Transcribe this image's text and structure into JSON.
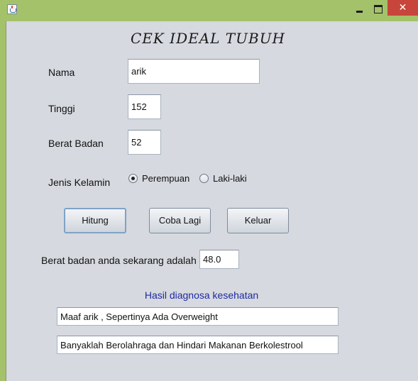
{
  "window": {
    "icon": "java-cup-icon",
    "controls": {
      "minimize": "minimize-icon",
      "maximize": "maximize-icon",
      "close": "close-icon"
    }
  },
  "form": {
    "title": "CEK IDEAL TUBUH",
    "nama_label": "Nama",
    "nama_value": "arik",
    "tinggi_label": "Tinggi",
    "tinggi_value": "152",
    "berat_label": "Berat Badan",
    "berat_value": "52",
    "gender_label": "Jenis Kelamin",
    "gender_options": [
      "Perempuan",
      "Laki-laki"
    ],
    "gender_selected": "Perempuan"
  },
  "buttons": {
    "hitung": "Hitung",
    "coba_lagi": "Coba Lagi",
    "keluar": "Keluar"
  },
  "result": {
    "label": "Berat badan anda sekarang adalah",
    "value": "48.0"
  },
  "diagnosis": {
    "heading": "Hasil diagnosa kesehatan",
    "line1": "Maaf arik , Sepertinya Ada Overweight",
    "line2": "Banyaklah Berolahraga dan Hindari Makanan Berkolestrool"
  },
  "colors": {
    "titlebar": "#a4c26a",
    "panel": "#d6d9df",
    "close_button": "#c7453b",
    "heading_blue": "#1f2aa0"
  }
}
